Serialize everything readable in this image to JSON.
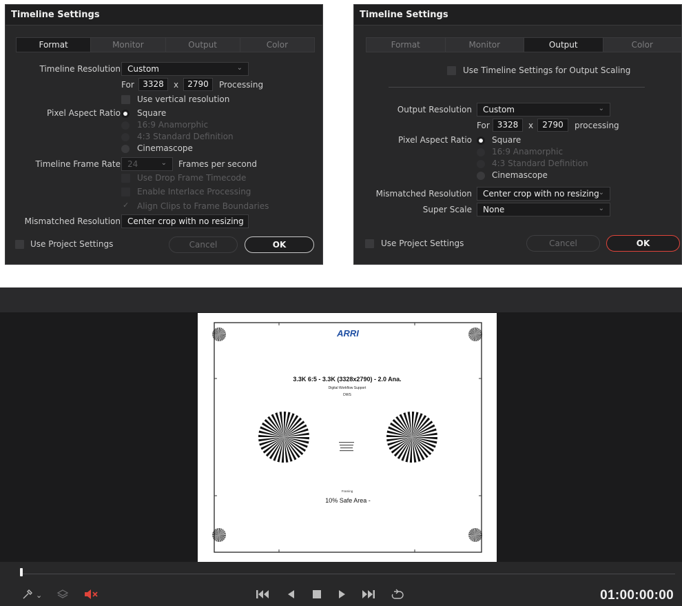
{
  "format_dialog": {
    "title": "Timeline Settings",
    "tabs": [
      "Format",
      "Monitor",
      "Output",
      "Color"
    ],
    "active_tab": "Format",
    "timeline_resolution_label": "Timeline Resolution",
    "timeline_resolution_value": "Custom",
    "for_label": "For",
    "width": "3328",
    "x_label": "x",
    "height": "2790",
    "processing_label": "Processing",
    "use_vertical_resolution": "Use vertical resolution",
    "pixel_aspect_ratio_label": "Pixel Aspect Ratio",
    "par_options": [
      "Square",
      "16:9 Anamorphic",
      "4:3 Standard Definition",
      "Cinemascope"
    ],
    "par_selected": "Square",
    "frame_rate_label": "Timeline Frame Rate",
    "frame_rate_value": "24",
    "frames_per_second": "Frames per second",
    "drop_frame": "Use Drop Frame Timecode",
    "interlace": "Enable Interlace Processing",
    "align_clips": "Align Clips to Frame Boundaries",
    "mismatched_label": "Mismatched Resolution",
    "mismatched_value": "Center crop with no resizing",
    "use_project_settings": "Use Project Settings",
    "cancel": "Cancel",
    "ok": "OK"
  },
  "output_dialog": {
    "title": "Timeline Settings",
    "tabs": [
      "Format",
      "Monitor",
      "Output",
      "Color"
    ],
    "active_tab": "Output",
    "use_timeline_settings": "Use Timeline Settings for Output Scaling",
    "output_resolution_label": "Output Resolution",
    "output_resolution_value": "Custom",
    "for_label": "For",
    "width": "3328",
    "x_label": "x",
    "height": "2790",
    "processing_label": "processing",
    "pixel_aspect_ratio_label": "Pixel Aspect Ratio",
    "par_options": [
      "Square",
      "16:9 Anamorphic",
      "4:3 Standard Definition",
      "Cinemascope"
    ],
    "par_selected": "Square",
    "mismatched_label": "Mismatched Resolution",
    "mismatched_value": "Center crop with no resizing",
    "super_scale_label": "Super Scale",
    "super_scale_value": "None",
    "use_project_settings": "Use Project Settings",
    "cancel": "Cancel",
    "ok": "OK",
    "ok_border_color": "#e0443a"
  },
  "viewer": {
    "chart_logo": "ARRI",
    "chart_title": "3.3K 6:5 - 3.3K (3328x2790) - 2.0 Ana.",
    "chart_sub1": "Digital Workflow Support",
    "chart_sub2": "DWS",
    "chart_framing": "Framing",
    "chart_safe_area": "10% Safe Area -",
    "timecode": "01:00:00:00",
    "playhead_position": 0.0,
    "audio_muted": true,
    "icons": [
      "eyedropper-icon",
      "chevron-down-icon",
      "layers-icon",
      "speaker-muted-icon",
      "skip-back-icon",
      "play-reverse-icon",
      "stop-icon",
      "play-icon",
      "skip-forward-icon",
      "loop-icon"
    ]
  }
}
